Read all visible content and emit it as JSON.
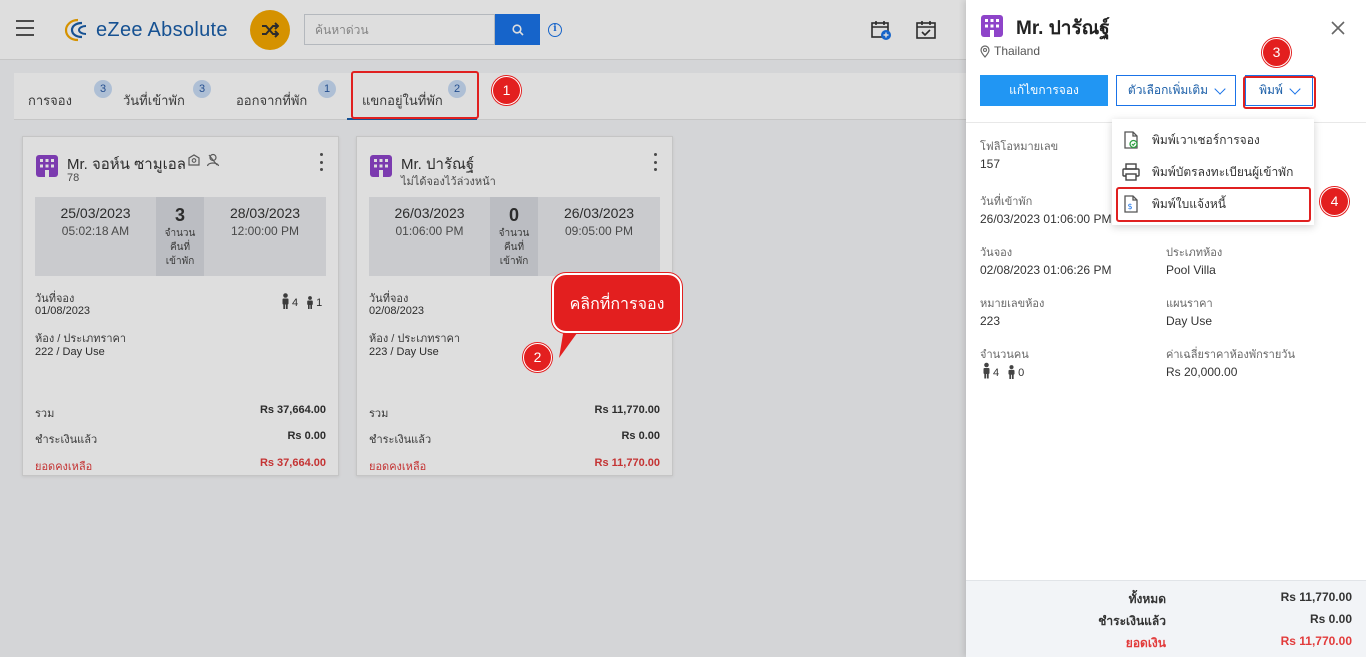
{
  "app": {
    "name": "eZee Absolute"
  },
  "search": {
    "placeholder": "ค้นหาด่วน"
  },
  "tabs": [
    {
      "label": "การจอง",
      "count": "3"
    },
    {
      "label": "วันที่เข้าพัก",
      "count": "3"
    },
    {
      "label": "ออกจากที่พัก",
      "count": "1"
    },
    {
      "label": "แขกอยู่ในที่พัก",
      "count": "2"
    }
  ],
  "cards": [
    {
      "guest_name": "Mr. จอห์น ซามูเอล",
      "sub": "78",
      "arrival_date": "25/03/2023",
      "arrival_time": "05:02:18 AM",
      "nights": "3",
      "nights_label_1": "จำนวน",
      "nights_label_2": "คืนที่",
      "nights_label_3": "เข้าพัก",
      "departure_date": "28/03/2023",
      "departure_time": "12:00:00 PM",
      "booking_date_label": "วันที่จอง",
      "booking_date": "01/08/2023",
      "adults": "4",
      "children": "1",
      "room_label": "ห้อง / ประเภทราคา",
      "room": "222 / Day Use",
      "total_label": "รวม",
      "total": "Rs 37,664.00",
      "paid_label": "ชำระเงินแล้ว",
      "paid": "Rs 0.00",
      "balance_label": "ยอดคงเหลือ",
      "balance": "Rs 37,664.00"
    },
    {
      "guest_name": "Mr. ปารัณฐ์",
      "sub": "ไม่ได้จองไว้ล่วงหน้า",
      "arrival_date": "26/03/2023",
      "arrival_time": "01:06:00 PM",
      "nights": "0",
      "nights_label_1": "จำนวน",
      "nights_label_2": "คืนที่",
      "nights_label_3": "เข้าพัก",
      "departure_date": "26/03/2023",
      "departure_time": "09:05:00 PM",
      "booking_date_label": "วันที่จอง",
      "booking_date": "02/08/2023",
      "room_label": "ห้อง / ประเภทราคา",
      "room": "223 / Day Use",
      "total_label": "รวม",
      "total": "Rs 11,770.00",
      "paid_label": "ชำระเงินแล้ว",
      "paid": "Rs 0.00",
      "balance_label": "ยอดคงเหลือ",
      "balance": "Rs 11,770.00"
    }
  ],
  "panel": {
    "guest_name": "Mr. ปารัณฐ์",
    "country": "Thailand",
    "edit_button": "แก้ไขการจอง",
    "more_options_button": "ตัวเลือกเพิ่มเติม",
    "print_button": "พิมพ์",
    "folio_label": "โฟลิโอหมายเลข",
    "folio": "157",
    "arrival_label": "วันที่เข้าพัก",
    "arrival": "26/03/2023 01:06:00 PM",
    "booking_label": "วันจอง",
    "booking": "02/08/2023 01:06:26 PM",
    "room_type_label": "ประเภทห้อง",
    "room_type": "Pool Villa",
    "room_no_label": "หมายเลขห้อง",
    "room_no": "223",
    "rate_plan_label": "แผนราคา",
    "rate_plan": "Day Use",
    "pax_label": "จำนวนคน",
    "adults": "4",
    "children": "0",
    "avg_rate_label": "ค่าเฉลี่ยราคาห้องพักรายวัน",
    "avg_rate": "Rs 20,000.00",
    "total_label": "ทั้งหมด",
    "total": "Rs 11,770.00",
    "paid_label": "ชำระเงินแล้ว",
    "paid": "Rs 0.00",
    "balance_label": "ยอดเงิน",
    "balance": "Rs 11,770.00"
  },
  "print_menu": [
    {
      "label": "พิมพ์เวาเชอร์การจอง",
      "icon": "voucher-icon"
    },
    {
      "label": "พิมพ์บัตรลงทะเบียนผู้เข้าพัก",
      "icon": "printer-icon"
    },
    {
      "label": "พิมพ์ใบแจ้งหนี้",
      "icon": "invoice-icon"
    }
  ],
  "annotations": {
    "callout_text": "คลิกที่การจอง",
    "m1": "1",
    "m2": "2",
    "m3": "3",
    "m4": "4"
  },
  "colors": {
    "primary": "#2196f3",
    "brand": "#1a5ea8",
    "accent": "#f5a800",
    "danger": "#e23b3b",
    "annotation": "#e31f1f"
  }
}
